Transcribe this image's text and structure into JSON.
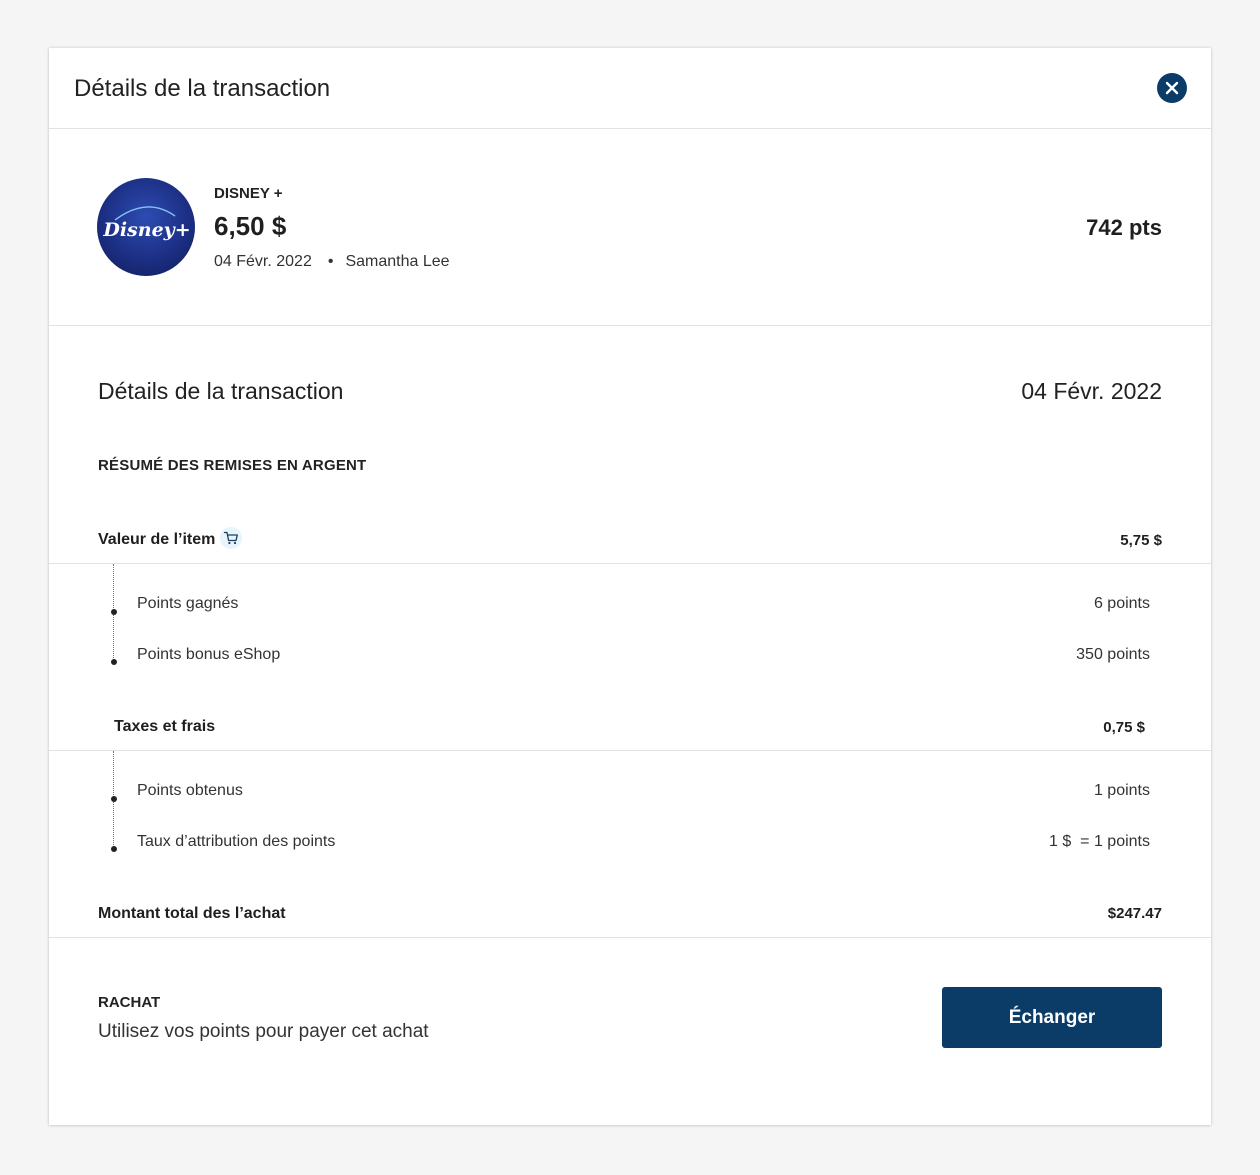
{
  "header": {
    "title": "Détails de la transaction",
    "close_icon": "close-icon"
  },
  "merchant": {
    "name": "DISNEY +",
    "amount": "6,50 $",
    "date": "04 Févr. 2022",
    "separator": "•",
    "user": "Samantha Lee",
    "points": "742 pts",
    "logo_text": "Disney+",
    "logo_color": "#1c2f84"
  },
  "details": {
    "title": "Détails de la transaction",
    "date": "04 Févr. 2022",
    "summary_title": "RÉSUMÉ DES REMISES EN ARGENT",
    "item": {
      "label": "Valeur de l’item",
      "icon": "cart-icon",
      "value": "5,75 $",
      "rows": [
        {
          "label": "Points gagnés",
          "value": "6 points"
        },
        {
          "label": "Points bonus eShop",
          "value": "350 points"
        }
      ]
    },
    "taxes": {
      "label": "Taxes et frais",
      "value": "0,75 $",
      "rows": [
        {
          "label": "Points obtenus",
          "value": "1 points"
        },
        {
          "label": "Taux d’attribution des points",
          "value": "1 $  = 1 points"
        }
      ]
    },
    "total": {
      "label": "Montant total des l’achat",
      "value": "$247.47"
    }
  },
  "redeem": {
    "title": "RACHAT",
    "description": "Utilisez vos points pour payer cet achat",
    "button_label": "Échanger"
  },
  "colors": {
    "primary": "#0b3c67",
    "accent_badge": "#e6f4fb"
  }
}
